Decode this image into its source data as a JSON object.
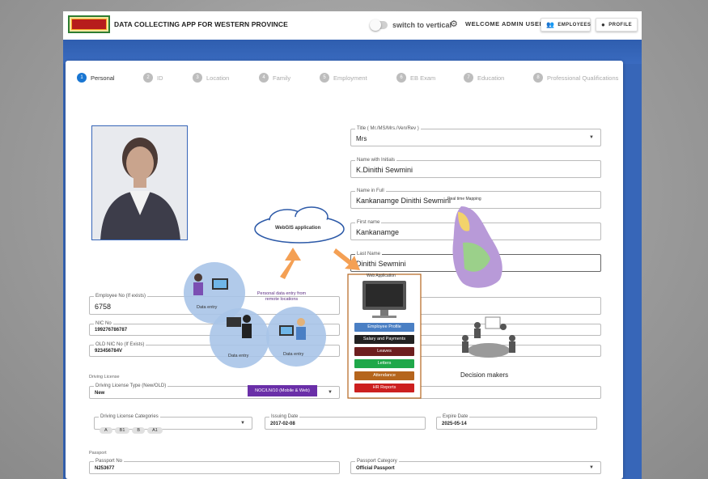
{
  "header": {
    "app_title": "DATA COLLECTING APP FOR WESTERN PROVINCE",
    "switch_label": "switch to vertical",
    "welcome": "WELCOME ADMIN USER",
    "employees_label": "EMPLOYEES",
    "profile_label": "PROFILE"
  },
  "steps": [
    {
      "num": "1",
      "label": "Personal"
    },
    {
      "num": "2",
      "label": "ID"
    },
    {
      "num": "3",
      "label": "Location"
    },
    {
      "num": "4",
      "label": "Family"
    },
    {
      "num": "5",
      "label": "Employment"
    },
    {
      "num": "6",
      "label": "EB Exam"
    },
    {
      "num": "7",
      "label": "Education"
    },
    {
      "num": "8",
      "label": "Professional Qualifications"
    }
  ],
  "form": {
    "title": {
      "label": "Title ( Mr./MS/Mrs./Ven/Rev )",
      "value": "Mrs"
    },
    "name_initials": {
      "label": "Name with Initials",
      "value": "K.Dinithi Sewmini"
    },
    "name_full": {
      "label": "Name in Full",
      "value": "Kankanamge Dinithi Sewmini"
    },
    "first_name": {
      "label": "First name",
      "value": "Kankanamge"
    },
    "last_name": {
      "label": "Last Name",
      "value": "Dinithi Sewmini"
    },
    "employee_no": {
      "label": "Employee No (If exists)",
      "value": "6758"
    },
    "nic_no": {
      "label": "NIC No",
      "value": "199276786787"
    },
    "old_nic": {
      "label": "OLD NIC No (If Exists)",
      "value": "923456784V"
    },
    "driving_license_section": "Driving License",
    "license_type": {
      "label": "Driving License Type (New/OLD)",
      "value": "New"
    },
    "license_categories": {
      "label": "Driving License Categories",
      "chips": [
        "A",
        "B1",
        "B",
        "A1"
      ]
    },
    "issuing_date": {
      "label": "Issuing Date",
      "value": "2017-02-08"
    },
    "expire_date": {
      "label": "Expire Date",
      "value": "2025-05-14"
    },
    "passport_section": "Passport",
    "passport_no": {
      "label": "Passport No",
      "value": "N253677"
    },
    "passport_category": {
      "label": "Passport Category",
      "value": "Official Passport"
    }
  },
  "overlay": {
    "webgis": "WebGIS application",
    "personal_entry": "Personal data entry from remote locations",
    "data_entry": "Data entry",
    "noc": "NOC/LN/10 (Mobile & Web)",
    "web_application": "Web Application",
    "map_label": "Real time Mapping",
    "decision_makers": "Decision makers",
    "app_buttons": [
      {
        "label": "Employee Profile",
        "color": "#4a7fc4"
      },
      {
        "label": "Salary and Payments",
        "color": "#222222"
      },
      {
        "label": "Leaves",
        "color": "#6d1f1f"
      },
      {
        "label": "Letters",
        "color": "#1fa84a"
      },
      {
        "label": "Attendance",
        "color": "#b5651d"
      },
      {
        "label": "HR Reports",
        "color": "#cc1f1f"
      }
    ]
  }
}
